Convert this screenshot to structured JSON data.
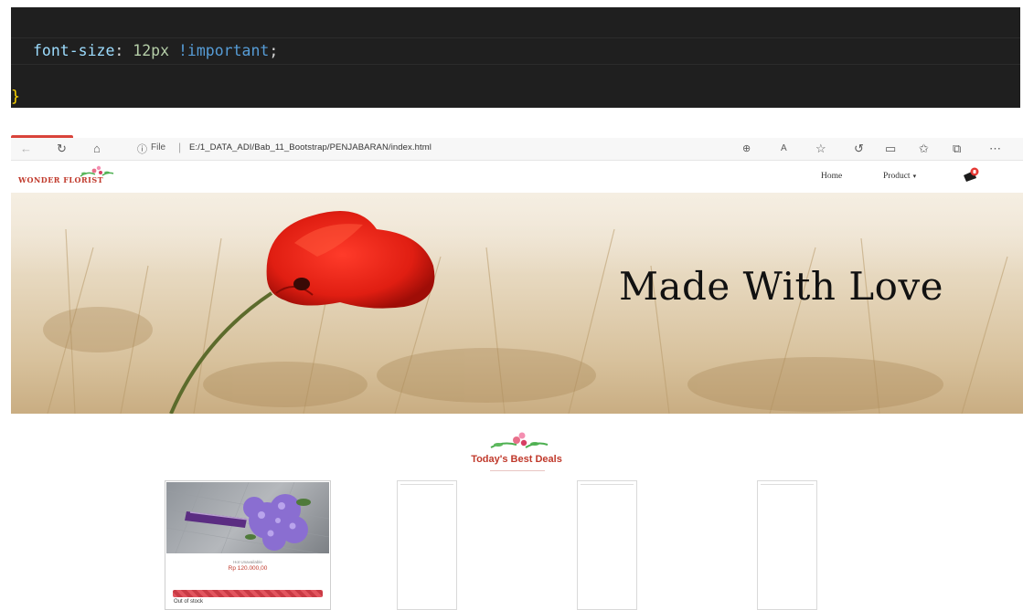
{
  "code": {
    "line1_property": "font-size",
    "line1_colon": ": ",
    "line1_number": "12px",
    "line1_space": " ",
    "line1_important": "!important",
    "line1_semicolon": ";",
    "line2_brace": "}"
  },
  "browser": {
    "back_icon": "←",
    "refresh_icon": "↻",
    "home_icon": "⌂",
    "info_icon": "ⓘ",
    "file_label": "File",
    "separator": "|",
    "url": "E:/1_DATA_ADI/Bab_11_Bootstrap/PENJABARAN/index.html",
    "toolbar_icons": [
      "⊕",
      "A",
      "☆",
      "↺",
      "▭",
      "✩",
      "⧉",
      "⋯"
    ]
  },
  "site": {
    "logo_text": "WONDER FLORIST",
    "nav": {
      "home": "Home",
      "product": "Product",
      "product_caret": "▾"
    },
    "hero_text": "Made With Love",
    "deals": {
      "title": "Today's Best Deals"
    },
    "product_card": {
      "category": "Hot Unavailable",
      "price": "Rp 120.000,00",
      "stock_status": "Out of stock"
    }
  },
  "colors": {
    "editor_bg": "#1f1f1f",
    "accent_red": "#c0392b",
    "hero_wheat": "#e6d7bd"
  }
}
